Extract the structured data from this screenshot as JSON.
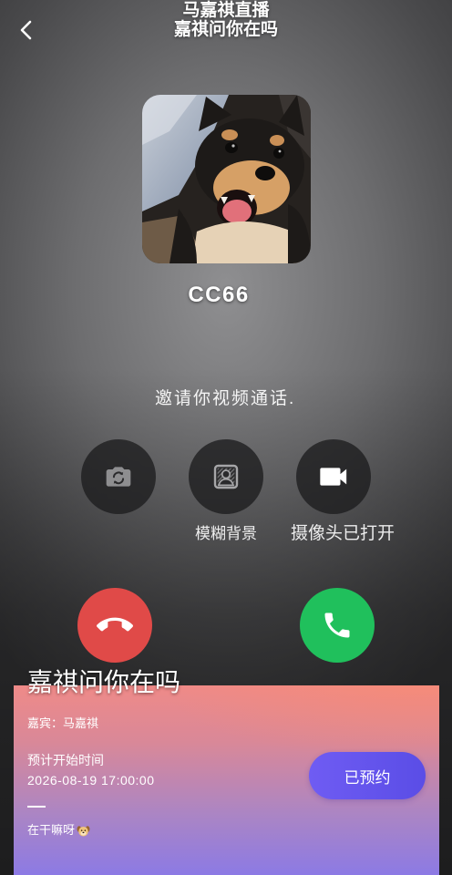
{
  "header": {
    "live_title": "马嘉祺直播",
    "subtitle": "嘉祺问你在吗",
    "back_icon": "chevron-left-icon"
  },
  "caller": {
    "avatar": "puppy-photo",
    "name": "CC66",
    "invite_text": "邀请你视频通话."
  },
  "controls": [
    {
      "icon": "camera-flip-icon"
    },
    {
      "icon": "blur-background-icon",
      "label": "模糊背景"
    },
    {
      "icon": "video-camera-icon",
      "label": "摄像头已打开"
    }
  ],
  "actions": {
    "decline_icon": "hang-up-icon",
    "accept_icon": "phone-icon",
    "decline_color": "#e04a48",
    "accept_color": "#20c05c"
  },
  "live_card": {
    "title": "嘉祺问你在吗",
    "guest": "嘉宾：马嘉祺",
    "start_label": "预计开始时间",
    "start_time": "2026-08-19 17:00:00",
    "message": "在干嘛呀",
    "message_icon": "dog-face-icon",
    "reserve_button": "已预约",
    "button_color": "#5a4de6"
  }
}
